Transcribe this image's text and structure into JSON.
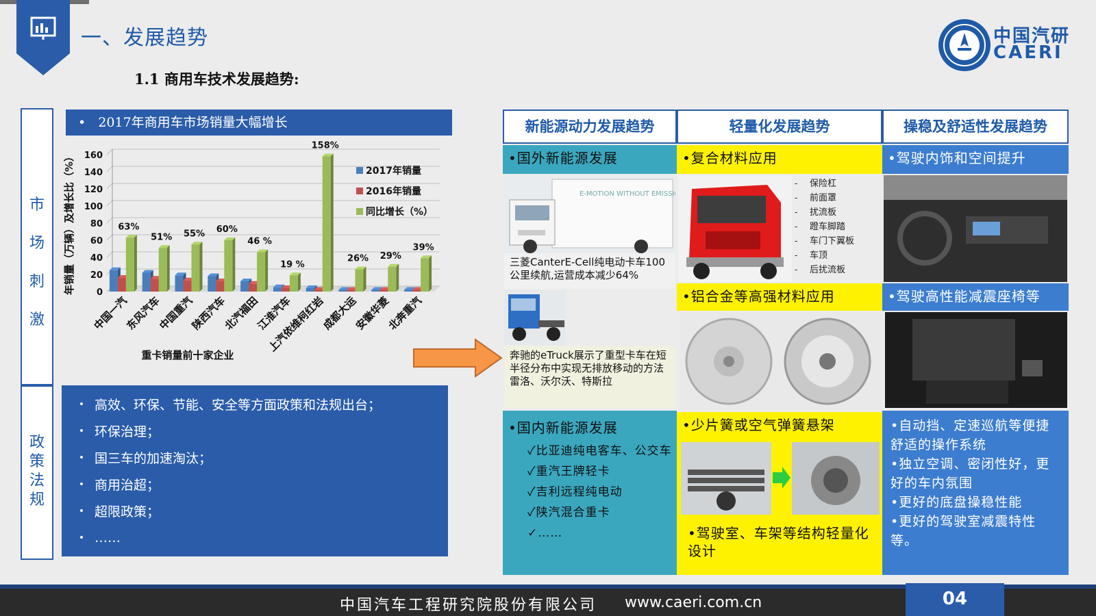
{
  "header": {
    "title": "一、发展趋势",
    "subtitle": "1.1 商用车技术发展趋势:",
    "logo_cn": "中国汽研",
    "logo_en": "CAERI"
  },
  "sections": {
    "market": "市场刺激",
    "policy": "政策法规"
  },
  "chart_header": "2017年商用车市场销量大幅增长",
  "chart_data": {
    "type": "bar",
    "xlabel": "重卡销量前十家企业",
    "ylabel": "年销量（万辆）及增长比（%）",
    "ylim": [
      0,
      160
    ],
    "yticks": [
      "0",
      "20",
      "40",
      "60",
      "80",
      "100",
      "120",
      "140",
      "160"
    ],
    "categories": [
      "中国一汽",
      "东风汽车",
      "中国重汽",
      "陕西汽车",
      "北汽福田",
      "江淮汽车",
      "上汽依维柯红岩",
      "成都大运",
      "安徽华菱",
      "北奔重汽"
    ],
    "series": [
      {
        "name": "2017年销量",
        "color": "#4a7ebb",
        "values": [
          25,
          22,
          19,
          18,
          12,
          5,
          4,
          2,
          2,
          2
        ]
      },
      {
        "name": "2016年销量",
        "color": "#c0504d",
        "values": [
          16,
          15,
          13,
          12,
          9,
          4,
          2,
          2,
          2,
          2
        ]
      },
      {
        "name": "同比增长（%）",
        "color": "#9bbb59",
        "values": [
          63,
          51,
          55,
          60,
          46,
          19,
          158,
          26,
          29,
          39
        ]
      }
    ],
    "data_labels": [
      "63%",
      "51%",
      "55%",
      "60%",
      "46 %",
      "19 %",
      "158%",
      "26%",
      "29%",
      "39%"
    ]
  },
  "policy_items": [
    "高效、环保、节能、安全等方面政策和法规出台；",
    "环保治理；",
    "国三车的加速淘汰；",
    "商用治超；",
    "超限政策；",
    "……"
  ],
  "columns": [
    "新能源动力发展趋势",
    "轻量化发展趋势",
    "操稳及舒适性发展趋势"
  ],
  "col1": {
    "foreign_title": "•国外新能源发展",
    "caption1": "三菱CanterE-Cell纯电动卡车100公里续航,运营成本减少64%",
    "caption2": "奔驰的eTruck展示了重型卡车在短半径分布中实现无排放移动的方法\n雷洛、沃尔沃、特斯拉",
    "domestic_title": "•国内新能源发展",
    "domestic_items": [
      "✓比亚迪纯电客车、公交车",
      "✓重汽王牌轻卡",
      "✓吉利远程纯电动",
      "✓陕汽混合重卡",
      "✓……"
    ]
  },
  "col2": {
    "composite_title": "•复合材料应用",
    "composite_parts": [
      "保险杠",
      "前面罩",
      "扰流板",
      "蹬车脚踏",
      "车门下翼板",
      "车顶",
      "后扰流板"
    ],
    "alloy_title": "•铝合金等高强材料应用",
    "spring_title": "•少片簧或空气弹簧悬架",
    "cab_title": "•驾驶室、车架等结构轻量化设计"
  },
  "col3": {
    "interior_title": "•驾驶内饰和空间提升",
    "seat_title": "•驾驶高性能减震座椅等",
    "comfort_items": [
      "•自动挡、定速巡航等便捷舒适的操作系统",
      "•独立空调、密闭性好，更好的车内氛围",
      "•更好的底盘操稳性能",
      "•更好的驾驶室减震特性等。"
    ]
  },
  "footer": {
    "company": "中国汽车工程研究院股份有限公司",
    "url": "www.caeri.com.cn",
    "page": "04"
  }
}
